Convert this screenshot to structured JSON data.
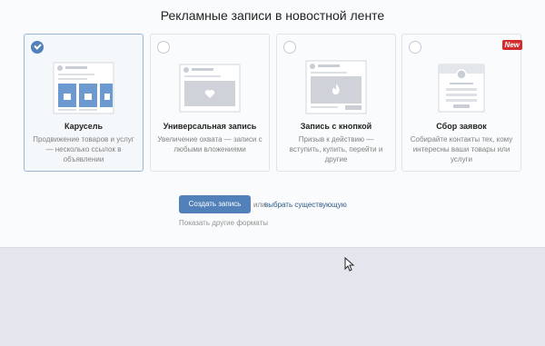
{
  "header": {
    "title": "Рекламные записи в новостной ленте"
  },
  "cards": [
    {
      "id": "carousel",
      "title": "Карусель",
      "description": "Продвижение товаров и услуг — несколько ссылок в объявлении",
      "selected": true,
      "illustration": "carousel-icon"
    },
    {
      "id": "universal",
      "title": "Универсальная запись",
      "description": "Увеличение охвата — записи с любыми вложениями",
      "selected": false,
      "illustration": "universal-post-icon"
    },
    {
      "id": "button",
      "title": "Запись с кнопкой",
      "description": "Призыв к действию — вступить, купить, перейти и другие",
      "selected": false,
      "illustration": "button-post-icon"
    },
    {
      "id": "leads",
      "title": "Сбор заявок",
      "description": "Собирайте контакты тех, кому интересны ваши товары или услуги",
      "selected": false,
      "badge": "New",
      "illustration": "lead-form-icon"
    }
  ],
  "actions": {
    "create_label": "Создать запись",
    "or_text": "или",
    "choose_label": "выбрать существующую",
    "other_formats_label": "Показать другие форматы"
  },
  "colors": {
    "accent": "#5181b8",
    "link": "#2a5885",
    "badge": "#d32b2b"
  }
}
